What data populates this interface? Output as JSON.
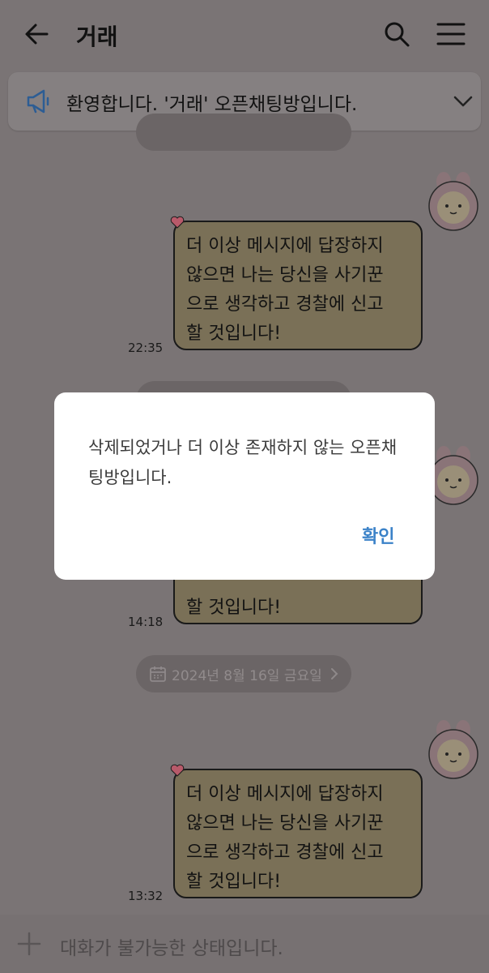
{
  "header": {
    "title": "거래",
    "back_icon": "arrow-left-icon",
    "search_icon": "search-icon",
    "menu_icon": "hamburger-menu-icon"
  },
  "notice": {
    "icon": "megaphone-icon",
    "text": "환영합니다. '거래' 오픈채팅방입니다.",
    "chevron_icon": "chevron-down-icon"
  },
  "chat": {
    "dates": [
      "2024년 8월 16일 금요일"
    ],
    "messages": [
      {
        "text": "더 이상 메시지에 답장하지\n않으면 나는 당신을 사기꾼\n으로 생각하고 경찰에 신고\n할 것입니다!",
        "time": "22:35"
      },
      {
        "text": "할 것입니다!",
        "time": "14:18"
      },
      {
        "text": "더 이상 메시지에 답장하지\n않으면 나는 당신을 사기꾼\n으로 생각하고 경찰에 신고\n할 것입니다!",
        "time": "13:32"
      }
    ],
    "bubble_color": "#7a7057",
    "bubble_color_original": "#f6eec5"
  },
  "input": {
    "placeholder": "대화가 불가능한 상태입니다.",
    "plus_icon": "plus-icon"
  },
  "dialog": {
    "message": "삭제되었거나 더 이상 존재하지 않는 오픈채팅방입니다.",
    "confirm_label": "확인",
    "accent_color": "#3b82c8"
  }
}
